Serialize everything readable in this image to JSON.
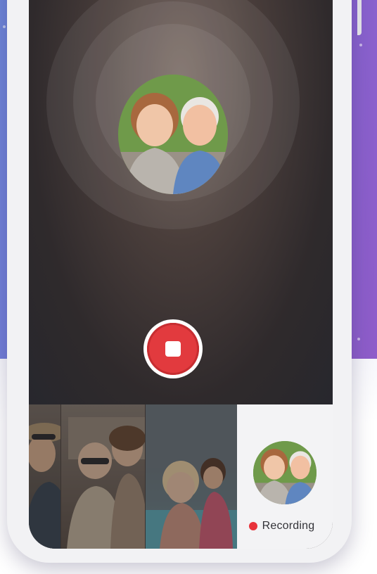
{
  "recording": {
    "status_label": "Recording"
  },
  "icons": {
    "stop": "stop-icon",
    "record_dot": "record-dot-icon"
  },
  "colors": {
    "record_red": "#e23a3e",
    "background_purple": "#7b6fd9",
    "thumbnail_panel": "#f3f3f5"
  }
}
